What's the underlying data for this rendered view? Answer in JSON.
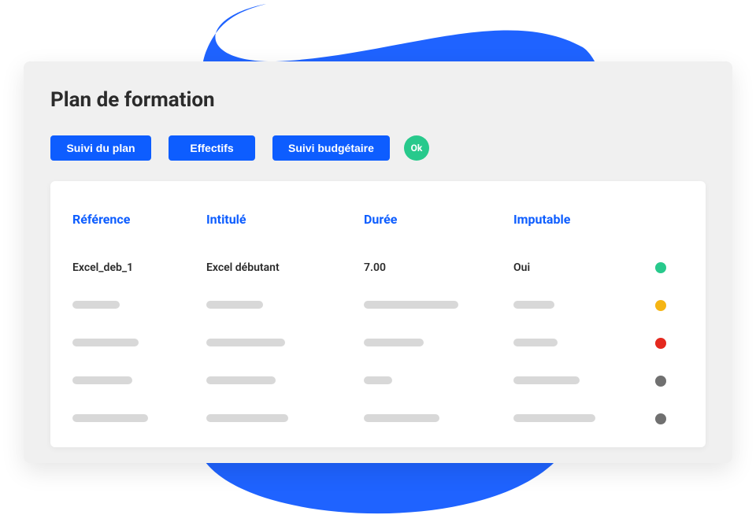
{
  "title": "Plan de formation",
  "toolbar": {
    "buttons": [
      {
        "label": "Suivi du plan"
      },
      {
        "label": "Effectifs"
      },
      {
        "label": "Suivi budgétaire"
      }
    ],
    "ok_label": "Ok"
  },
  "table": {
    "headers": {
      "reference": "Référence",
      "intitule": "Intitulé",
      "duree": "Durée",
      "imputable": "Imputable"
    },
    "rows": [
      {
        "reference": "Excel_deb_1",
        "intitule": "Excel débutant",
        "duree": "7.00",
        "imputable": "Oui",
        "status_color": "#28c98c"
      },
      {
        "placeholder": true,
        "widths": [
          60,
          72,
          120,
          52
        ],
        "status_color": "#f5b514"
      },
      {
        "placeholder": true,
        "widths": [
          84,
          100,
          76,
          56
        ],
        "status_color": "#e4291f"
      },
      {
        "placeholder": true,
        "widths": [
          76,
          88,
          36,
          84
        ],
        "status_color": "#707070"
      },
      {
        "placeholder": true,
        "widths": [
          96,
          104,
          96,
          104
        ],
        "status_color": "#707070"
      }
    ]
  },
  "colors": {
    "primary": "#0d5dff",
    "accent": "#28c98c"
  }
}
